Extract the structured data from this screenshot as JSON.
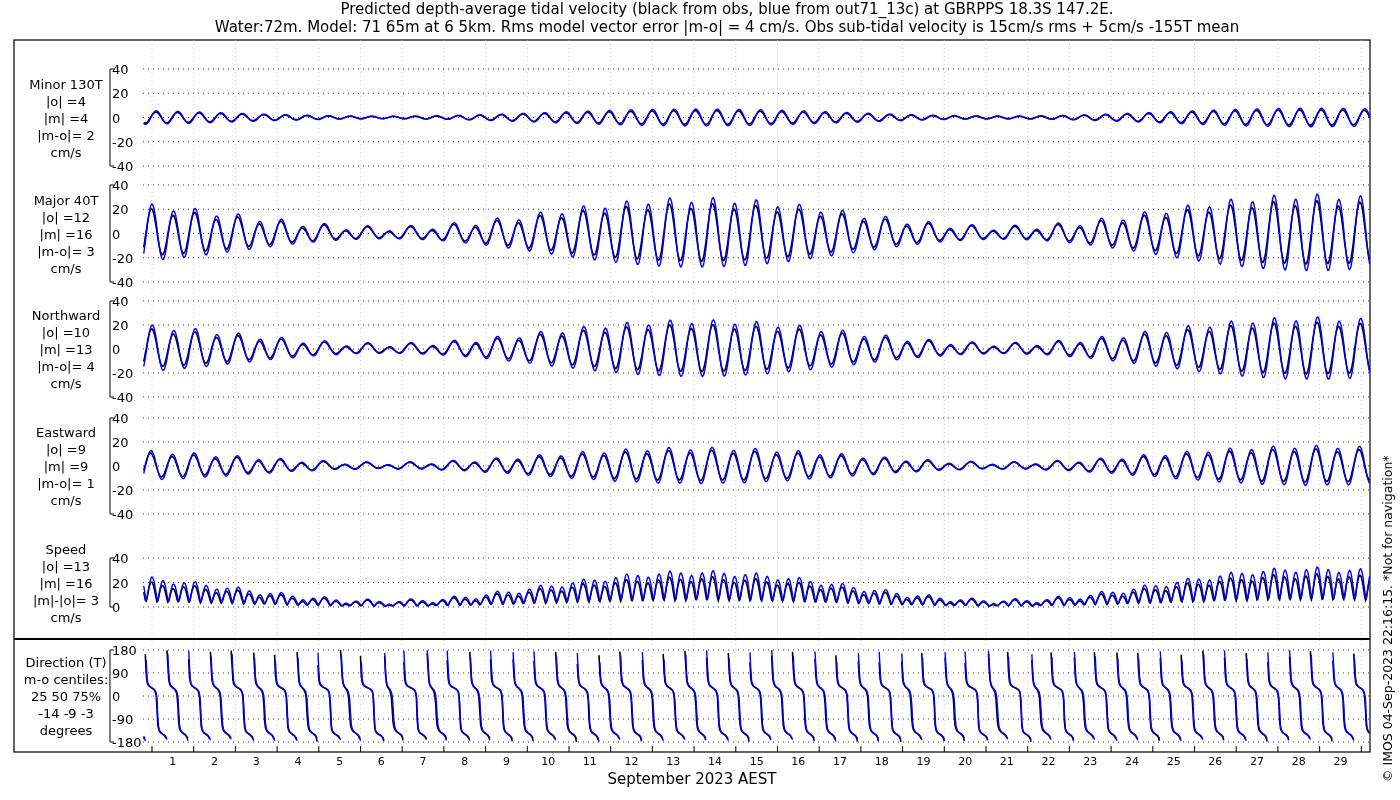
{
  "title": [
    "Predicted depth-average tidal velocity (black from obs, blue from out71_13c) at GBRPPS 18.3S 147.2E.",
    "Water:72m. Model: 71 65m at 6 5km. Rms model vector error |m-o| = 4 cm/s. Obs sub-tidal velocity is 15cm/s rms + 5cm/s -155T mean"
  ],
  "panels": [
    {
      "kind": "minor",
      "label": [
        "Minor 130T",
        "|o| =4",
        "|m| =4",
        "|m-o|= 2",
        "cm/s"
      ],
      "yticks": [
        "40",
        "20",
        "0",
        "-20",
        "-40"
      ]
    },
    {
      "kind": "major",
      "label": [
        "Major 40T",
        "|o| =12",
        "|m| =16",
        "|m-o|= 3",
        "cm/s"
      ],
      "yticks": [
        "40",
        "20",
        "0",
        "-20",
        "-40"
      ]
    },
    {
      "kind": "northward",
      "label": [
        "Northward",
        "|o| =10",
        "|m| =13",
        "|m-o|= 4",
        "cm/s"
      ],
      "yticks": [
        "40",
        "20",
        "0",
        "-20",
        "-40"
      ]
    },
    {
      "kind": "eastward",
      "label": [
        "Eastward",
        "|o| =9",
        "|m| =9",
        "|m-o|= 1",
        "cm/s"
      ],
      "yticks": [
        "40",
        "20",
        "0",
        "-20",
        "-40"
      ]
    },
    {
      "kind": "speed",
      "label": [
        "Speed",
        "|o| =13",
        "|m| =16",
        "|m|-|o|= 3",
        "cm/s"
      ],
      "yticks": [
        "40",
        "20",
        "0"
      ]
    },
    {
      "kind": "direction",
      "label": [
        "Direction (T)",
        "m-o centiles:",
        "25  50  75%",
        "-14  -9  -3",
        "degrees"
      ],
      "yticks": [
        "180",
        "90",
        "0",
        "-90",
        "-180"
      ]
    }
  ],
  "x_days": [
    "1",
    "2",
    "3",
    "4",
    "5",
    "6",
    "7",
    "8",
    "9",
    "10",
    "11",
    "12",
    "13",
    "14",
    "15",
    "16",
    "17",
    "18",
    "19",
    "20",
    "21",
    "22",
    "23",
    "24",
    "25",
    "26",
    "27",
    "28",
    "29"
  ],
  "xlabel": "September 2023 AEST",
  "footer": "© IMOS 04-Sep-2023 22:16:15. *Not for navigation*"
}
